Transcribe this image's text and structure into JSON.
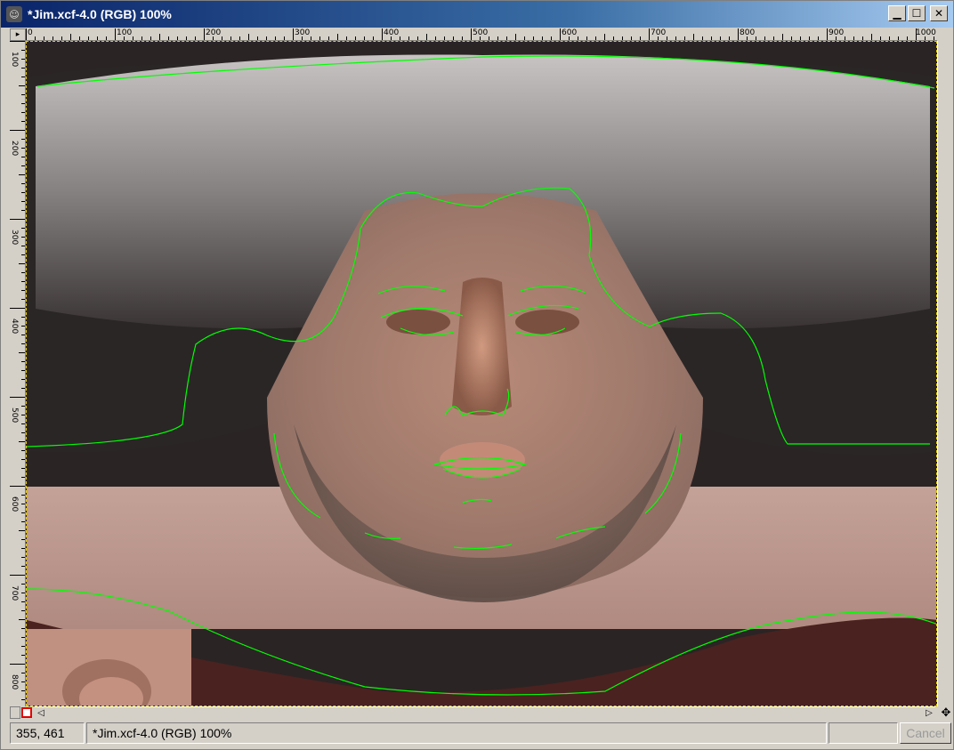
{
  "window": {
    "title": "*Jim.xcf-4.0 (RGB) 100%",
    "buttons": {
      "minimize": "▁",
      "maximize": "☐",
      "close": "✕"
    }
  },
  "rulers": {
    "horizontal_labels": [
      "0",
      "100",
      "200",
      "300",
      "400",
      "500",
      "600",
      "700",
      "800",
      "900",
      "1000"
    ],
    "vertical_labels": [
      "100",
      "200",
      "300",
      "400",
      "500",
      "600",
      "700",
      "800"
    ]
  },
  "status": {
    "coordinates": "355, 461",
    "message": "*Jim.xcf-4.0 (RGB) 100%",
    "cancel_label": "Cancel"
  },
  "colors": {
    "selection_outline": "#00ff00",
    "title_start": "#0a246a",
    "title_end": "#a6caf0"
  }
}
